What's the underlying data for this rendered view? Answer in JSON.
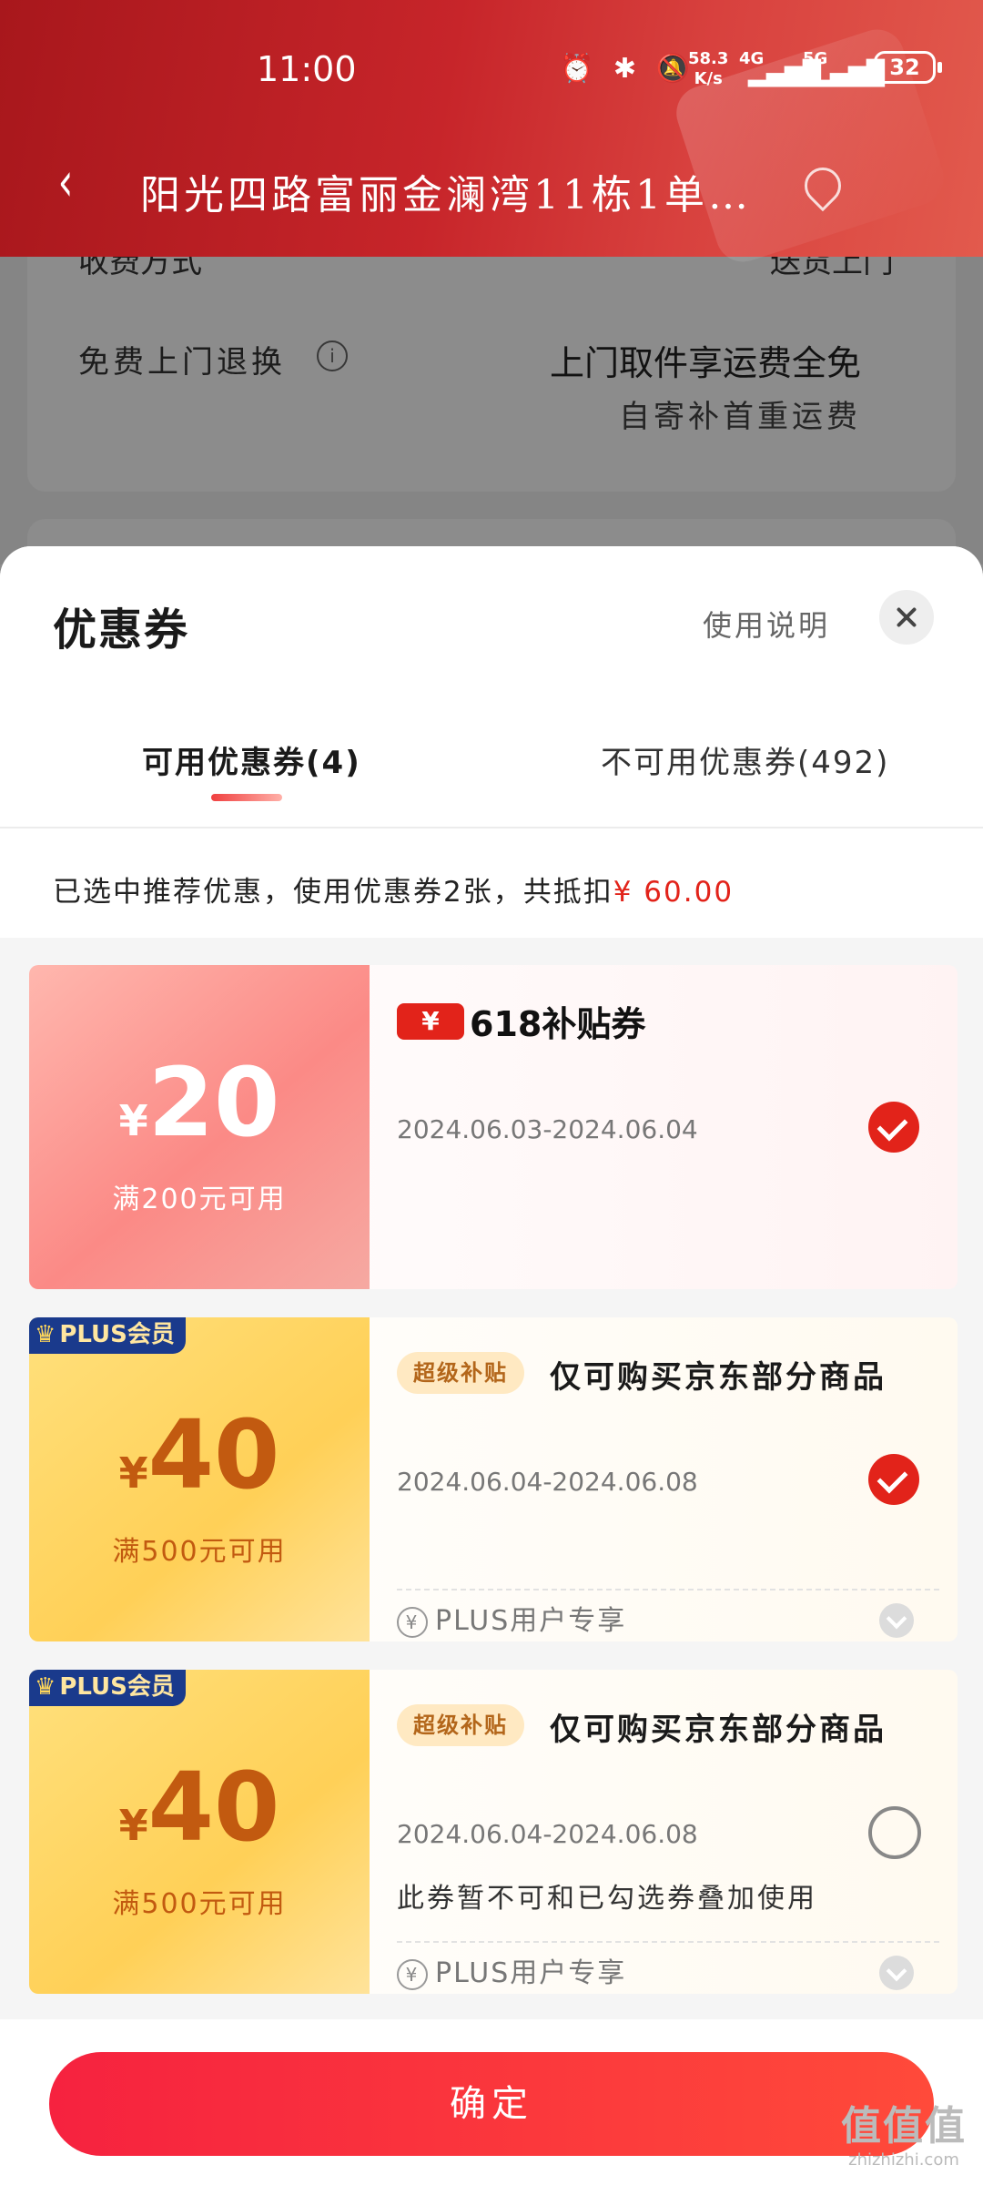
{
  "status_bar": {
    "time": "11:00",
    "icons": "⏰ ✱ 🔕",
    "net_speed": "58.3",
    "net_unit": "K/s",
    "signal_a": "4G",
    "signal_b": "5G",
    "battery": "32"
  },
  "nav": {
    "back_glyph": "‹",
    "address": "阳光四路富丽金澜湾11栋1单…"
  },
  "background": {
    "row1_label": "收费方式",
    "row1_value": "送货上门",
    "row2_label": "免费上门退换",
    "row2_info": "i",
    "row2_value": "上门取件享运费全免",
    "row3_value": "自寄补首重运费"
  },
  "sheet": {
    "title": "优惠券",
    "usage_label": "使用说明",
    "tabs": [
      {
        "label": "可用优惠券(4)"
      },
      {
        "label": "不可用优惠券(492)"
      }
    ],
    "summary_text": "已选中推荐优惠，使用优惠券2张，共抵扣",
    "summary_amount": "¥ 60.00"
  },
  "coupons": [
    {
      "currency": "¥",
      "amount": "20",
      "condition": "满200元可用",
      "tag_yen": "¥",
      "tag_label": "618补贴券",
      "date": "2024.06.03-2024.06.04",
      "selected": true
    },
    {
      "badge": "PLUS会员",
      "currency": "¥",
      "amount": "40",
      "condition": "满500元可用",
      "super_tag": "超级补贴",
      "scope": "仅可购买京东部分商品",
      "date": "2024.06.04-2024.06.08",
      "plus_only_icon": "¥",
      "plus_only": "PLUS用户专享",
      "selected": true
    },
    {
      "badge": "PLUS会员",
      "currency": "¥",
      "amount": "40",
      "condition": "满500元可用",
      "super_tag": "超级补贴",
      "scope": "仅可购买京东部分商品",
      "date": "2024.06.04-2024.06.08",
      "note": "此券暂不可和已勾选券叠加使用",
      "plus_only_icon": "¥",
      "plus_only": "PLUS用户专享",
      "selected": false
    }
  ],
  "footer": {
    "confirm_label": "确定"
  },
  "watermark": {
    "big": "值值值",
    "small": "zhizhizhi.com"
  },
  "colors": {
    "accent_red": "#e2231a",
    "header_red": "#c7252a",
    "plus_navy": "#1a3a8c",
    "gold_text": "#c25a10"
  }
}
